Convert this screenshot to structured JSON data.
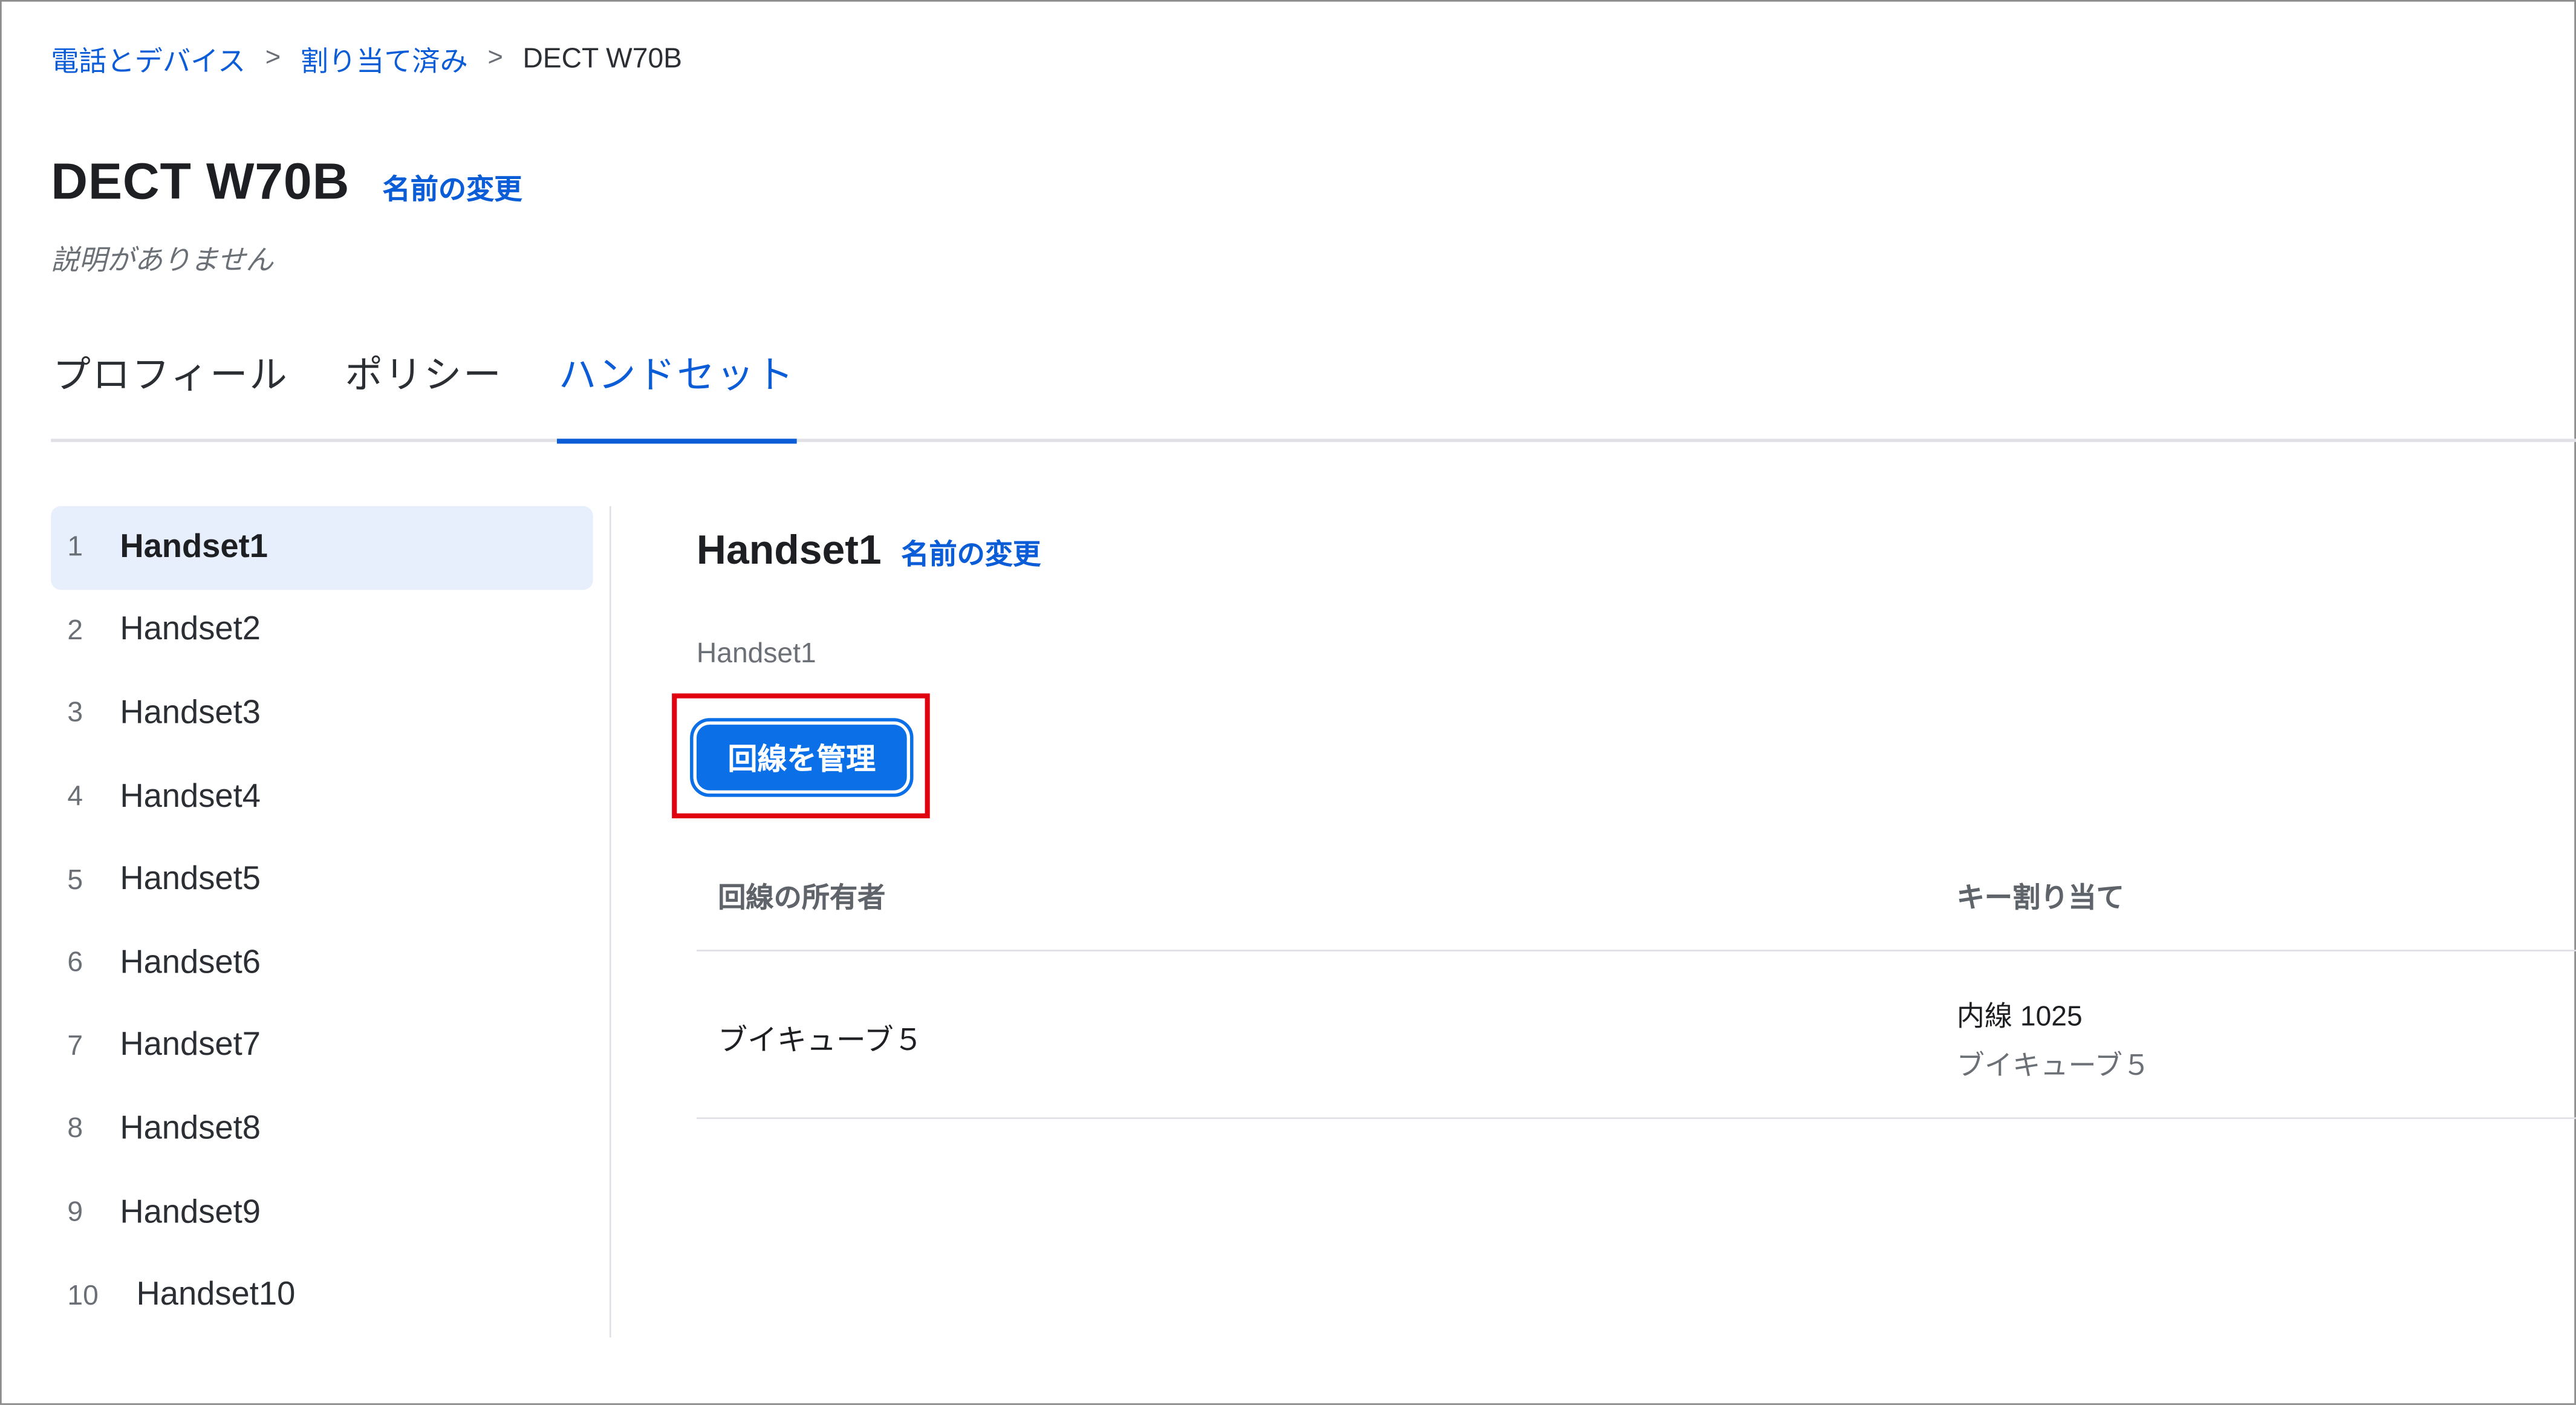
{
  "breadcrumb": {
    "items": [
      {
        "label": "電話とデバイス"
      },
      {
        "label": "割り当て済み"
      },
      {
        "label": "DECT W70B"
      }
    ],
    "separator": ">"
  },
  "device": {
    "title": "DECT W70B",
    "rename_label": "名前の変更",
    "description": "説明がありません"
  },
  "tabs": [
    {
      "label": "プロフィール",
      "active": false
    },
    {
      "label": "ポリシー",
      "active": false
    },
    {
      "label": "ハンドセット",
      "active": true
    }
  ],
  "sidebar": {
    "items": [
      {
        "num": "1",
        "label": "Handset1",
        "selected": true
      },
      {
        "num": "2",
        "label": "Handset2"
      },
      {
        "num": "3",
        "label": "Handset3"
      },
      {
        "num": "4",
        "label": "Handset4"
      },
      {
        "num": "5",
        "label": "Handset5"
      },
      {
        "num": "6",
        "label": "Handset6"
      },
      {
        "num": "7",
        "label": "Handset7"
      },
      {
        "num": "8",
        "label": "Handset8"
      },
      {
        "num": "9",
        "label": "Handset9"
      },
      {
        "num": "10",
        "label": "Handset10"
      }
    ]
  },
  "panel": {
    "title": "Handset1",
    "rename_label": "名前の変更",
    "subtitle": "Handset1",
    "manage_button": "回線を管理",
    "table": {
      "headers": [
        "回線の所有者",
        "キー割り当て"
      ],
      "rows": [
        {
          "owner": "ブイキューブ５",
          "key_assignment": "内線 1025",
          "key_assignment_sub": "ブイキューブ５"
        }
      ]
    }
  },
  "colors": {
    "accent": "#0b5cd7",
    "button": "#0b6fe8",
    "highlight": "#e0000f",
    "selected_row": "#e7effc"
  }
}
